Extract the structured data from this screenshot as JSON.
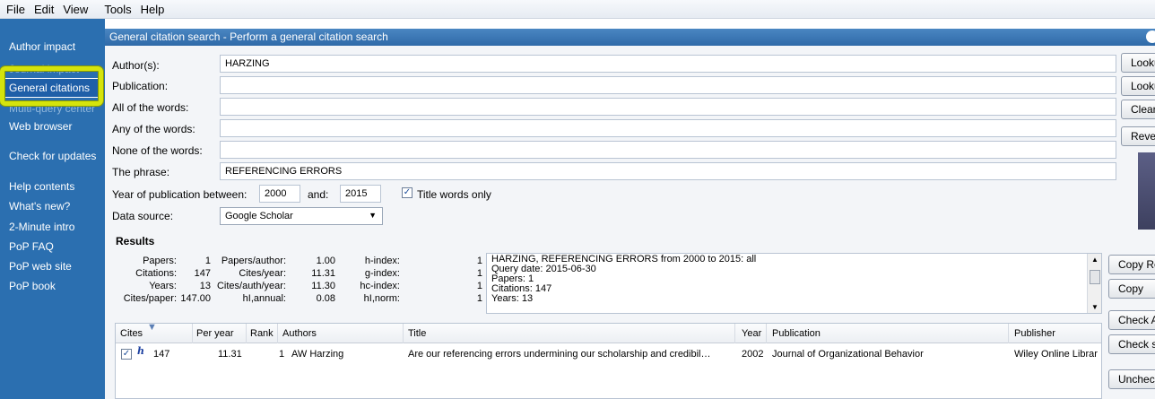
{
  "menu": [
    "File",
    "Edit",
    "View",
    "Tools",
    "Help"
  ],
  "sidebar": {
    "author_impact": "Author impact",
    "general_citations": "General citations",
    "multi_query_center": "Multi-query center",
    "web_browser": "Web browser",
    "check_updates": "Check for updates",
    "help_contents": "Help contents",
    "whats_new": "What's new?",
    "intro": "2-Minute intro",
    "faq": "PoP FAQ",
    "web_site": "PoP web site",
    "book": "PoP book"
  },
  "panel": {
    "title": "General citation search - Perform a general citation search"
  },
  "form": {
    "authors_label": "Author(s):",
    "authors_value": "HARZING",
    "publication_label": "Publication:",
    "publication_value": "",
    "all_words_label": "All of the words:",
    "all_words_value": "",
    "any_words_label": "Any of the words:",
    "any_words_value": "",
    "none_words_label": "None of the words:",
    "none_words_value": "",
    "phrase_label": "The phrase:",
    "phrase_value": "REFERENCING ERRORS",
    "year_label": "Year of publication between:",
    "year_from": "2000",
    "and_label": "and:",
    "year_to": "2015",
    "title_words_label": "Title words only",
    "title_words_checked": true,
    "data_source_label": "Data source:",
    "data_source_value": "Google Scholar"
  },
  "buttons": {
    "lookup": "Lookup",
    "lookup_direct": "Lookup Direct",
    "clear_all": "Clear All",
    "revert": "Revert",
    "copy_results": "Copy Results",
    "copy": "Copy",
    "check_all": "Check All",
    "check_selected": "Check selected",
    "uncheck": "Uncheck"
  },
  "results": {
    "title": "Results",
    "metrics": {
      "papers_label": "Papers:",
      "papers": "1",
      "citations_label": "Citations:",
      "citations": "147",
      "years_label": "Years:",
      "years": "13",
      "cites_paper_label": "Cites/paper:",
      "cites_paper": "147.00",
      "papers_author_label": "Papers/author:",
      "papers_author": "1.00",
      "cites_year_label": "Cites/year:",
      "cites_year": "11.31",
      "cites_auth_year_label": "Cites/auth/year:",
      "cites_auth_year": "11.30",
      "hi_annual_label": "hI,annual:",
      "hi_annual": "0.08",
      "h_index_label": "h-index:",
      "h_index": "1",
      "g_index_label": "g-index:",
      "g_index": "1",
      "hc_index_label": "hc-index:",
      "hc_index": "1",
      "hi_norm_label": "hI,norm:",
      "hi_norm": "1"
    },
    "summary": {
      "line1": "HARZING, REFERENCING ERRORS from 2000 to 2015: all",
      "line2": "Query date: 2015-06-30",
      "line3": "Papers: 1",
      "line4": "Citations: 147",
      "line5": "Years: 13"
    },
    "columns": {
      "cites": "Cites",
      "per_year": "Per year",
      "rank": "Rank",
      "authors": "Authors",
      "title": "Title",
      "year": "Year",
      "publication": "Publication",
      "publisher": "Publisher"
    },
    "rows": [
      {
        "checked": true,
        "cites": "147",
        "per_year": "11.31",
        "rank": "1",
        "authors": "AW Harzing",
        "title": "Are our referencing errors undermining our scholarship and credibil…",
        "year": "2002",
        "publication": "Journal of Organizational Behavior",
        "publisher": "Wiley Online Librar"
      }
    ]
  },
  "colors": {
    "sidebar": "#2b6fb0",
    "header": "#3a76b6",
    "highlight": "#d5e40c"
  }
}
